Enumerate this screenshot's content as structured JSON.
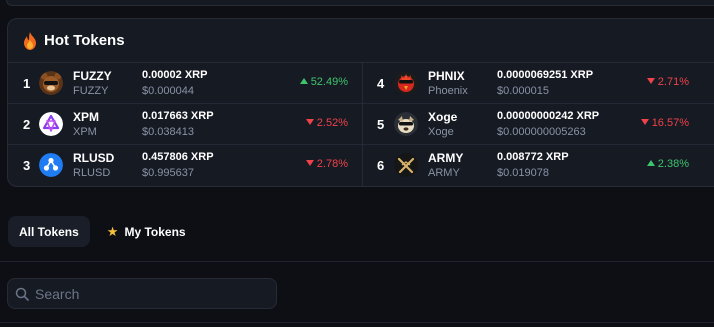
{
  "hot_tokens": {
    "title": "Hot Tokens",
    "icon": "flame-icon",
    "left": [
      {
        "rank": "1",
        "symbol": "FUZZY",
        "name": "FUZZY",
        "price": "0.00002 XRP",
        "usd": "$0.000044",
        "change": "52.49%",
        "direction": "up",
        "avatar": "fuzzy-bear-avatar"
      },
      {
        "rank": "2",
        "symbol": "XPM",
        "name": "XPM",
        "price": "0.017663 XRP",
        "usd": "$0.038413",
        "change": "2.52%",
        "direction": "down",
        "avatar": "xpm-logo"
      },
      {
        "rank": "3",
        "symbol": "RLUSD",
        "name": "RLUSD",
        "price": "0.457806 XRP",
        "usd": "$0.995637",
        "change": "2.78%",
        "direction": "down",
        "avatar": "rlusd-logo"
      }
    ],
    "right": [
      {
        "rank": "4",
        "symbol": "PHNIX",
        "name": "Phoenix",
        "price": "0.0000069251 XRP",
        "usd": "$0.000015",
        "change": "2.71%",
        "direction": "down",
        "avatar": "phoenix-bird-avatar"
      },
      {
        "rank": "5",
        "symbol": "Xoge",
        "name": "Xoge",
        "price": "0.00000000242 XRP",
        "usd": "$0.000000005263",
        "change": "16.57%",
        "direction": "down",
        "avatar": "xoge-dog-avatar"
      },
      {
        "rank": "6",
        "symbol": "ARMY",
        "name": "ARMY",
        "price": "0.008772 XRP",
        "usd": "$0.019078",
        "change": "2.38%",
        "direction": "up",
        "avatar": "army-swords-avatar"
      }
    ]
  },
  "tabs": [
    {
      "label": "All Tokens",
      "active": true
    },
    {
      "label": "My Tokens",
      "active": false,
      "icon": "star-icon"
    }
  ],
  "search": {
    "placeholder": "Search",
    "value": ""
  },
  "colors": {
    "up": "#3ec46d",
    "down": "#f0424a",
    "star": "#f4c038",
    "panel": "#161a23"
  }
}
